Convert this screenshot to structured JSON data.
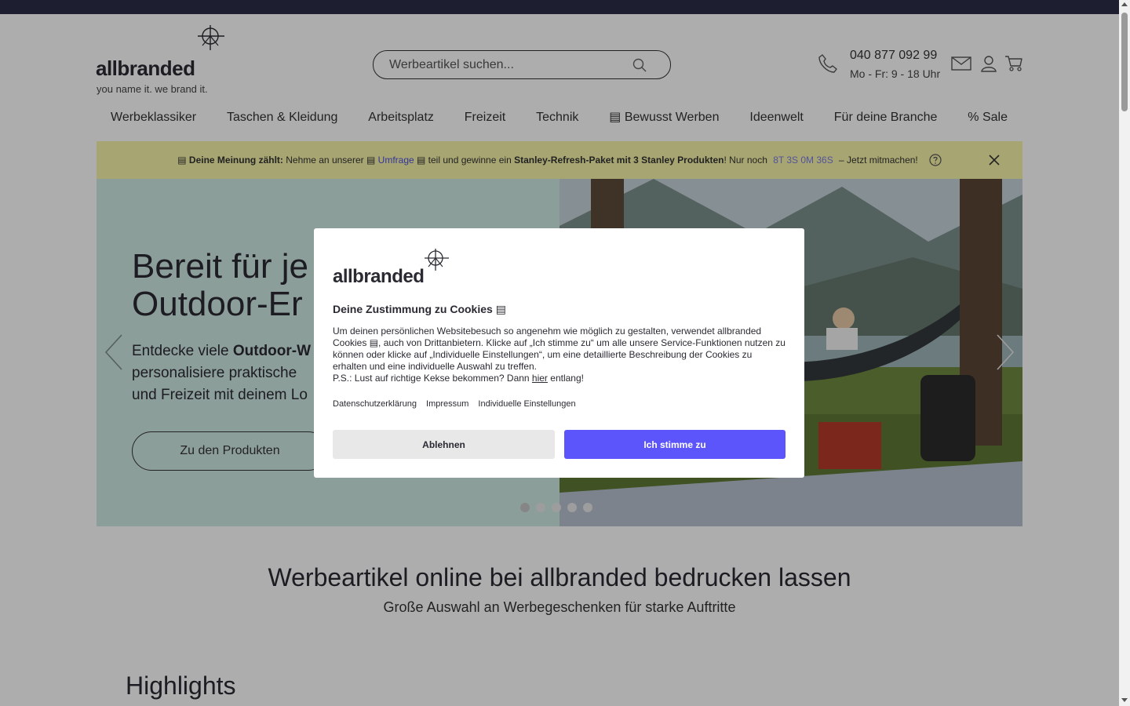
{
  "header": {
    "logo_text": "allbranded",
    "tagline": "you name it. we brand it.",
    "search_placeholder": "Werbeartikel suchen...",
    "phone": "040 877 092 99",
    "hours": "Mo - Fr: 9 - 18 Uhr",
    "icons": [
      "phone-icon",
      "mail-icon",
      "user-icon",
      "cart-icon",
      "search-icon"
    ]
  },
  "nav": {
    "items": [
      {
        "label": "Werbeklassiker"
      },
      {
        "label": "Taschen & Kleidung"
      },
      {
        "label": "Arbeitsplatz"
      },
      {
        "label": "Freizeit"
      },
      {
        "label": "Technik"
      },
      {
        "label": "▤ Bewusst Werben"
      },
      {
        "label": "Ideenwelt"
      },
      {
        "label": "Für deine Branche"
      },
      {
        "label": "% Sale"
      }
    ]
  },
  "promo": {
    "prefix_icon": "▤",
    "bold_lead": "Deine Meinung zählt:",
    "text1": " Nehme an unserer ",
    "link_icon": "▤",
    "link": "Umfrage",
    "text2": " ▤ teil und gewinne ein ",
    "prize": "Stanley-Refresh-Paket mit 3 Stanley Produkten",
    "text3": "! Nur noch ",
    "countdown": "8T 3S 0M 36S",
    "text4": " – Jetzt mitmachen!"
  },
  "hero": {
    "title_line1": "Bereit für je",
    "title_line2": "Outdoor-Er",
    "text_pre": "Entdecke viele ",
    "text_bold": "Outdoor-W",
    "text_line2": "personalisiere praktische",
    "text_line3": "und Freizeit mit deinem Lo",
    "button": "Zu den Produkten",
    "active_slide": 1,
    "slide_count": 5
  },
  "section": {
    "title": "Werbeartikel online bei allbranded bedrucken lassen",
    "subtitle": "Große Auswahl an Werbegeschenken für starke Auftritte",
    "highlights": "Highlights"
  },
  "cookie": {
    "logo_text": "allbranded",
    "title": "Deine Zustimmung zu Cookies ▤",
    "body": "Um deinen persönlichen Websitebesuch so angenehm wie möglich zu gestalten, verwendet allbranded Cookies ▤, auch von Drittanbietern. Klicke auf „Ich stimme zu“ um alle unsere Service-Funktionen nutzen zu können oder klicke auf „Individuelle Einstellungen“, um eine detaillierte Beschreibung der Cookies zu erhalten und eine individuelle Auswahl zu treffen.",
    "ps_pre": "P.S.: Lust auf richtige Kekse bekommen? Dann ",
    "ps_link": "hier",
    "ps_post": " entlang!",
    "links": [
      "Datenschutzerklärung",
      "Impressum",
      "Individuelle Einstellungen"
    ],
    "decline": "Ablehnen",
    "accept": "Ich stimme zu",
    "accent_color": "#5b55fb"
  }
}
